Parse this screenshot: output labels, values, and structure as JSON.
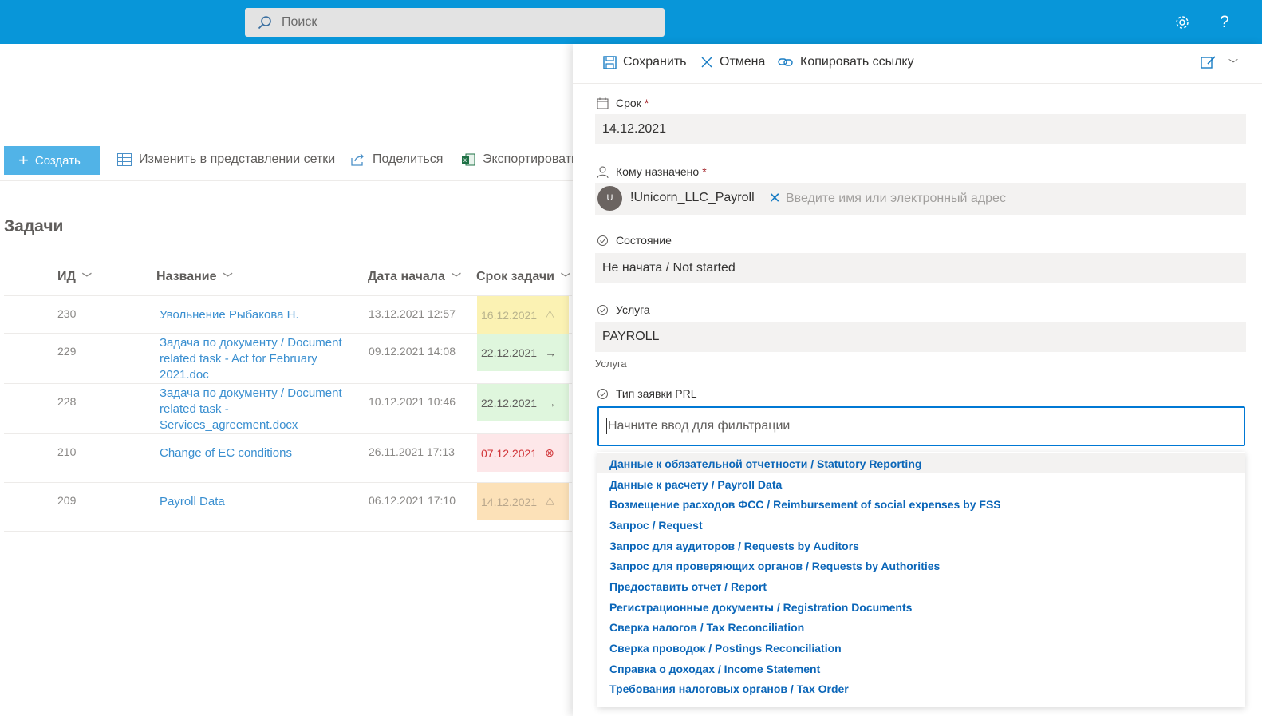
{
  "topbar": {
    "search_placeholder": "Поиск",
    "settings_icon": "gear-icon",
    "help_label": "?"
  },
  "list": {
    "create_label": "Создать",
    "grid_edit_label": "Изменить в представлении сетки",
    "share_label": "Поделиться",
    "export_label": "Экспортировать",
    "title": "Задачи",
    "columns": {
      "id": "ИД",
      "name": "Название",
      "start": "Дата начала",
      "due": "Срок задачи"
    },
    "rows": [
      {
        "id": "230",
        "title": "Увольнение Рыбакова Н.",
        "start": "13.12.2021 12:57",
        "due": "16.12.2021",
        "status_icon": "warning-icon",
        "due_bg": "#fbf2b3",
        "due_color": "#b9b48d"
      },
      {
        "id": "229",
        "title": "Задача по документу / Document related task - Act for February 2021.doc",
        "start": "09.12.2021 14:08",
        "due": "22.12.2021",
        "status_icon": "arrow-right-icon",
        "due_bg": "#dff6dd",
        "due_color": "#605e5c"
      },
      {
        "id": "228",
        "title": "Задача по документу / Document related task - Services_agreement.docx",
        "start": "10.12.2021 10:46",
        "due": "22.12.2021",
        "status_icon": "arrow-right-icon",
        "due_bg": "#dff6dd",
        "due_color": "#605e5c"
      },
      {
        "id": "210",
        "title": "Change of EC conditions",
        "start": "26.11.2021 17:13",
        "due": "07.12.2021",
        "status_icon": "error-circle-icon",
        "due_bg": "#fde7e9",
        "due_color": "#d13438"
      },
      {
        "id": "209",
        "title": "Payroll Data",
        "start": "06.12.2021 17:10",
        "due": "14.12.2021",
        "status_icon": "warning-icon",
        "due_bg": "#fce1b8",
        "due_color": "#b9a78d"
      }
    ]
  },
  "panel": {
    "save_label": "Сохранить",
    "cancel_label": "Отмена",
    "copy_link_label": "Копировать ссылку",
    "fields": {
      "due_label": "Срок",
      "due_value": "14.12.2021",
      "assigned_label": "Кому назначено",
      "assigned_person": "!Unicorn_LLC_Payroll",
      "assigned_initial": "U",
      "assigned_placeholder": "Введите имя или электронный адрес",
      "status_label": "Состояние",
      "status_value": "Не начата / Not started",
      "service_label": "Услуга",
      "service_value": "PAYROLL",
      "service_helper": "Услуга",
      "request_type_label": "Тип заявки PRL",
      "request_type_placeholder": "Начните ввод для фильтрации",
      "required_mark": "*"
    },
    "options": [
      "Данные к обязательной отчетности / Statutory Reporting",
      "Данные к расчету / Payroll Data",
      "Возмещение расходов ФСС / Reimbursement of social expenses by FSS",
      "Запрос / Request",
      "Запрос для аудиторов / Requests by Auditors",
      "Запрос для проверяющих органов / Requests by Authorities",
      "Предоставить отчет / Report",
      "Регистрационные документы / Registration Documents",
      "Сверка налогов / Tax Reconciliation",
      "Сверка проводок / Postings Reconciliation",
      "Справка о доходах / Income Statement",
      "Требования налоговых органов / Tax Order"
    ]
  }
}
